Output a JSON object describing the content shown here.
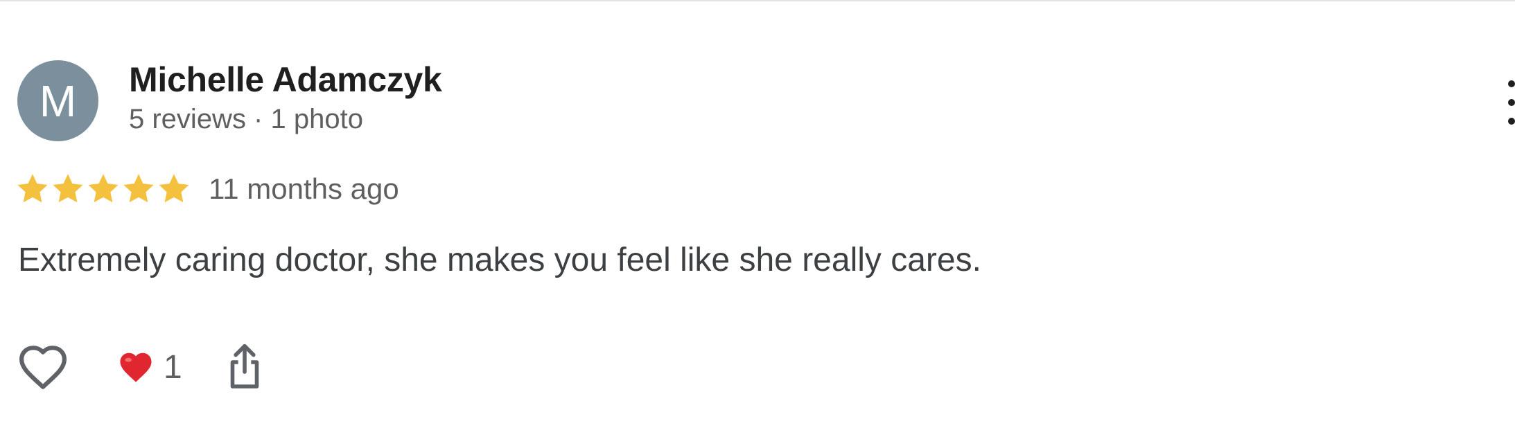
{
  "review": {
    "author": {
      "initial": "M",
      "name": "Michelle Adamczyk",
      "meta": "5 reviews · 1 photo",
      "avatar_color": "#7c8f9c"
    },
    "rating": {
      "stars": 5,
      "max_stars": 5,
      "star_color": "#f4c13e",
      "time_ago": "11 months ago"
    },
    "text": "Extremely caring doctor, she makes you feel like she really cares.",
    "reactions": {
      "like_icon": "heart-outline-icon",
      "emoji_icon": "red-heart-icon",
      "count": "1",
      "share_icon": "share-icon",
      "menu_icon": "more-vertical-icon"
    }
  }
}
